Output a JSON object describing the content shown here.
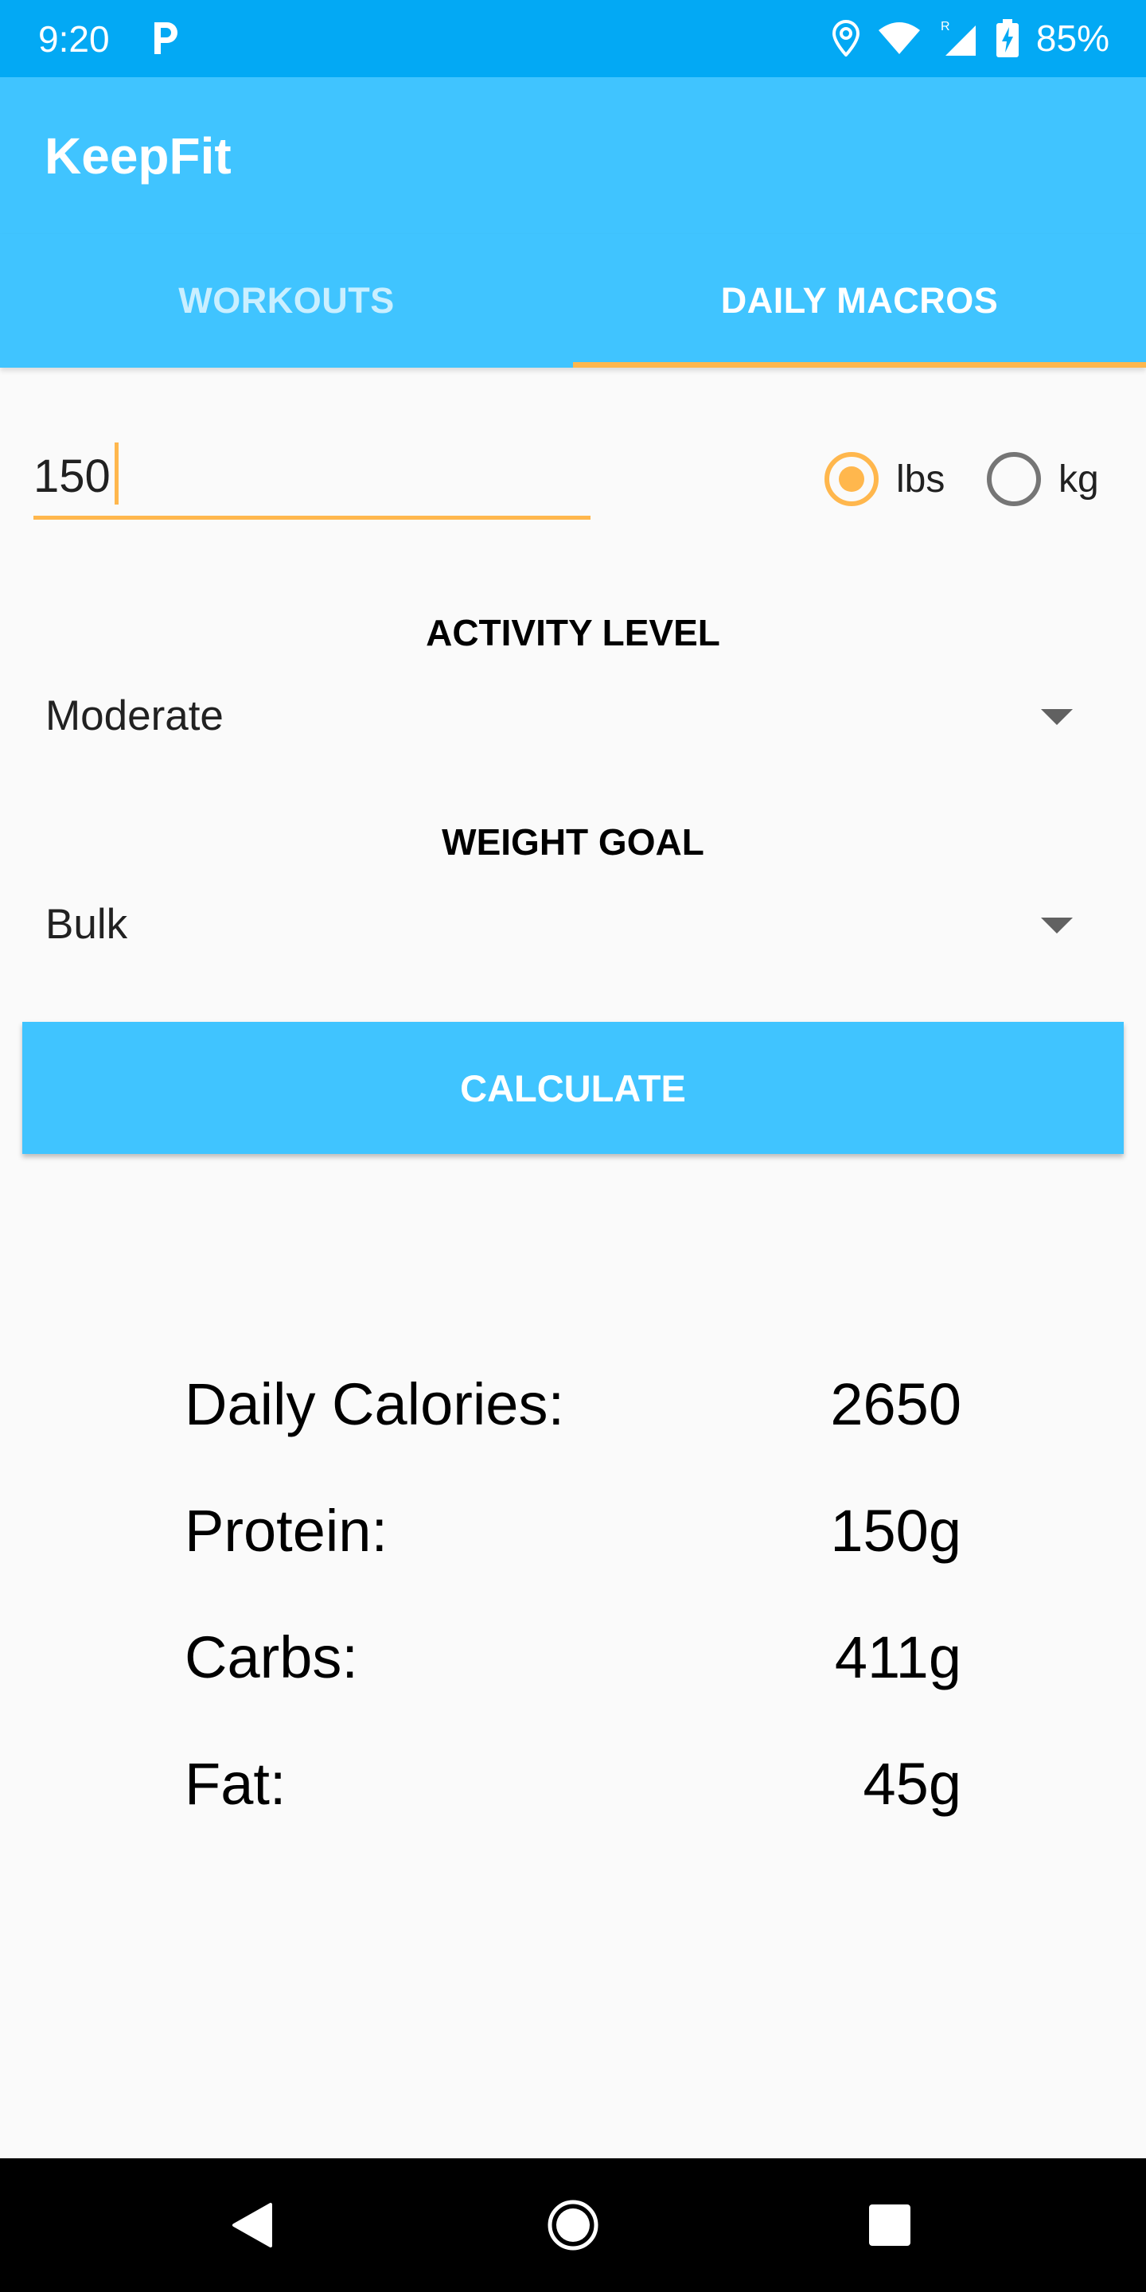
{
  "status_bar": {
    "time": "9:20",
    "battery": "85%",
    "icons": [
      "parking-icon",
      "location-icon",
      "wifi-icon",
      "signal-icon",
      "battery-charging-icon"
    ]
  },
  "app": {
    "title": "KeepFit"
  },
  "tabs": [
    {
      "label": "WORKOUTS",
      "active": false
    },
    {
      "label": "DAILY MACROS",
      "active": true
    }
  ],
  "weight": {
    "value": "150",
    "unit_options": [
      {
        "label": "lbs",
        "checked": true
      },
      {
        "label": "kg",
        "checked": false
      }
    ]
  },
  "activity_level": {
    "label": "ACTIVITY LEVEL",
    "selected": "Moderate"
  },
  "weight_goal": {
    "label": "WEIGHT GOAL",
    "selected": "Bulk"
  },
  "calculate_button": {
    "label": "CALCULATE"
  },
  "results": [
    {
      "label": "Daily Calories:",
      "value": "2650"
    },
    {
      "label": "Protein:",
      "value": "150g"
    },
    {
      "label": "Carbs:",
      "value": "411g"
    },
    {
      "label": "Fat:",
      "value": "45g"
    }
  ],
  "colors": {
    "status_bar": "#03a9f4",
    "primary": "#40c4ff",
    "accent": "#ffb74d",
    "nav_bar": "#000000"
  }
}
